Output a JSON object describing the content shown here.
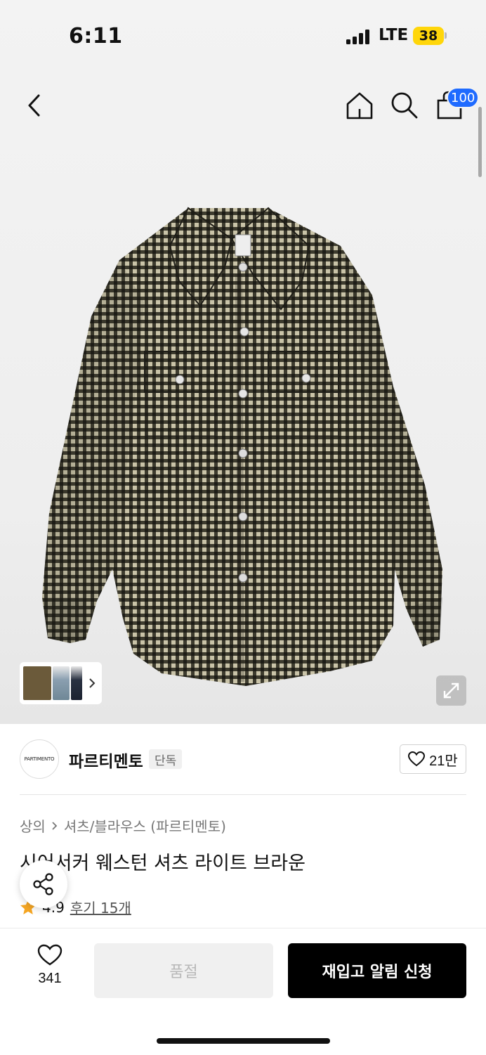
{
  "status_bar": {
    "time": "6:11",
    "network": "LTE",
    "battery": "38"
  },
  "header": {
    "cart_count": "100"
  },
  "brand": {
    "logo_text": "PARTIMENTO",
    "name": "파르티멘토",
    "badge": "단독",
    "likes": "21만"
  },
  "breadcrumb": {
    "category": "상의",
    "subcategory": "셔츠/블라우스 (파르티멘토)"
  },
  "product": {
    "title": "시어서커 웨스턴 셔츠 라이트 브라운",
    "rating": "4.9",
    "reviews": "후기 15개"
  },
  "bottom_bar": {
    "wish_count": "341",
    "soldout_label": "품절",
    "restock_label": "재입고 알림 신청"
  },
  "colors": {
    "accent_blue": "#1f6bff",
    "battery_yellow": "#ffd60a",
    "star_orange": "#f5a623",
    "shirt_olive": "#4f4c3b"
  },
  "icons": [
    "back-icon",
    "home-icon",
    "search-icon",
    "cart-icon",
    "expand-icon",
    "heart-icon",
    "share-icon",
    "star-icon",
    "chevron-right-icon"
  ]
}
